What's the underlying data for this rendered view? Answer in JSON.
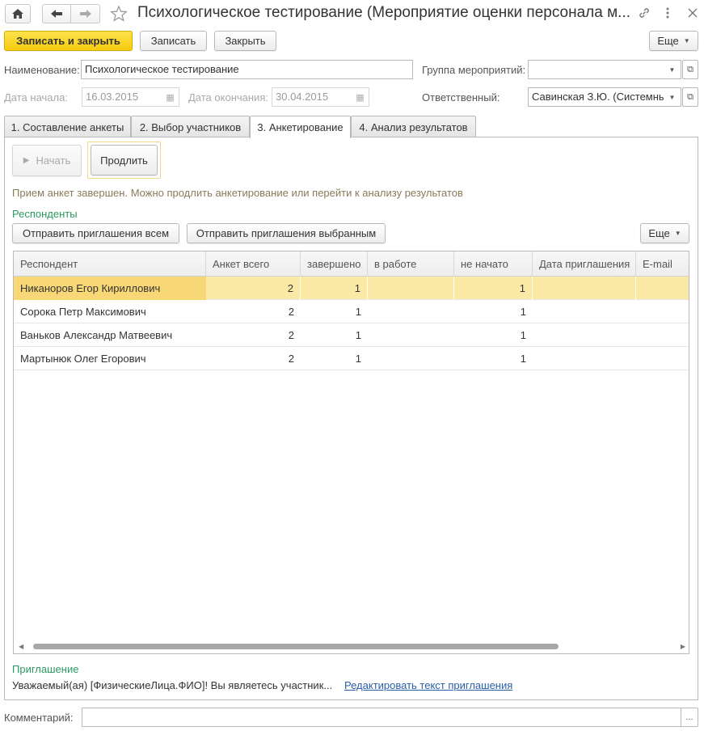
{
  "window": {
    "title": "Психологическое тестирование (Мероприятие оценки персонала м...",
    "home_icon": "home-icon",
    "back_icon": "arrow-left-icon",
    "forward_icon": "arrow-right-icon",
    "star_icon": "star-icon",
    "link_icon": "link-icon",
    "menu_icon": "more-vertical-icon",
    "close_icon": "close-icon"
  },
  "toolbar": {
    "save_close_label": "Записать и закрыть",
    "save_label": "Записать",
    "close_label": "Закрыть",
    "more_label": "Еще"
  },
  "form": {
    "name_label": "Наименование:",
    "name_value": "Психологическое тестирование",
    "group_label": "Группа мероприятий:",
    "group_value": "",
    "start_label": "Дата начала:",
    "start_value": "16.03.2015",
    "end_label": "Дата окончания:",
    "end_value": "30.04.2015",
    "responsible_label": "Ответственный:",
    "responsible_value": "Савинская З.Ю. (Системный"
  },
  "tabs": [
    {
      "label": "1. Составление анкеты"
    },
    {
      "label": "2. Выбор участников"
    },
    {
      "label": "3. Анкетирование"
    },
    {
      "label": "4. Анализ результатов"
    }
  ],
  "survey": {
    "start_label": "Начать",
    "extend_label": "Продлить",
    "status_text": "Прием анкет завершен. Можно продлить анкетирование или перейти к анализу результатов",
    "respondents_title": "Респонденты",
    "send_all_label": "Отправить приглашения всем",
    "send_selected_label": "Отправить приглашения выбранным",
    "more_label": "Еще"
  },
  "table": {
    "columns": [
      "Респондент",
      "Анкет всего",
      "завершено",
      "в работе",
      "не начато",
      "Дата приглашения",
      "E-mail"
    ],
    "rows": [
      {
        "name": "Никаноров Егор Кириллович",
        "total": "2",
        "done": "1",
        "in_work": "",
        "not_started": "1",
        "date": "",
        "email": ""
      },
      {
        "name": "Сорока Петр Максимович",
        "total": "2",
        "done": "1",
        "in_work": "",
        "not_started": "1",
        "date": "",
        "email": ""
      },
      {
        "name": "Ваньков Александр Матвеевич",
        "total": "2",
        "done": "1",
        "in_work": "",
        "not_started": "1",
        "date": "",
        "email": ""
      },
      {
        "name": "Мартынюк Олег Егорович",
        "total": "2",
        "done": "1",
        "in_work": "",
        "not_started": "1",
        "date": "",
        "email": ""
      }
    ]
  },
  "invitation": {
    "title": "Приглашение",
    "text": "Уважаемый(ая) [ФизическиеЛица.ФИО]! Вы являетесь участник...",
    "edit_link": "Редактировать текст приглашения"
  },
  "comment": {
    "label": "Комментарий:",
    "value": ""
  },
  "colors": {
    "accent": "#f5cc0c",
    "selected_row": "#fbe9a6",
    "group_title": "#2b9a5e",
    "link": "#2a5ea8"
  }
}
